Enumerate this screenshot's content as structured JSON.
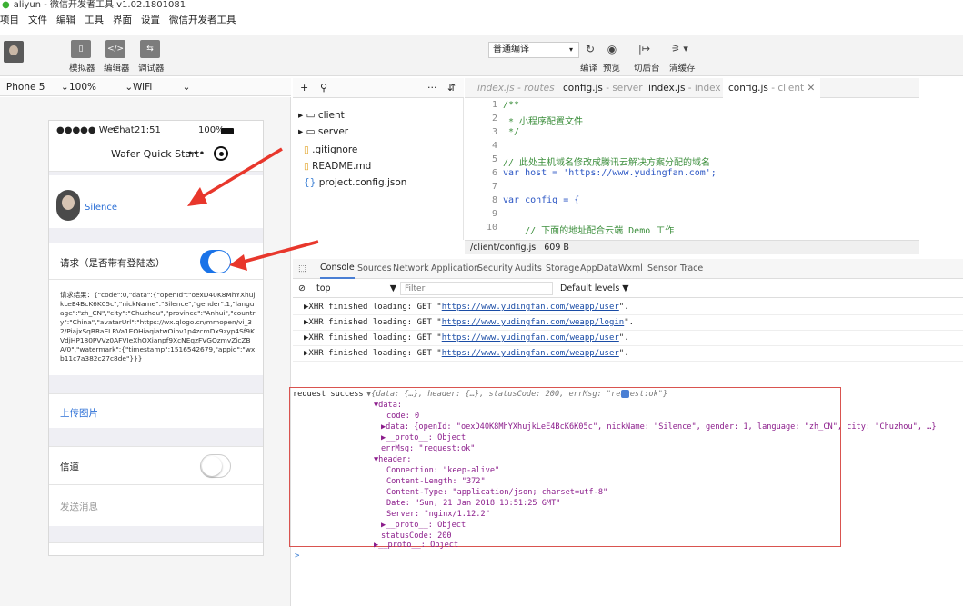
{
  "window": {
    "title": "aliyun - 微信开发者工具 v1.02.1801081"
  },
  "menu": [
    "项目",
    "文件",
    "编辑",
    "工具",
    "界面",
    "设置",
    "微信开发者工具"
  ],
  "toolbar": {
    "simulator": "模拟器",
    "editor": "编辑器",
    "debugger": "调试器",
    "compile_mode": "普通编译",
    "compile": "编译",
    "preview": "预览",
    "backend": "切后台",
    "clear_cache": "清缓存"
  },
  "device": {
    "model": "iPhone 5",
    "zoom": "100%",
    "network": "WiFi"
  },
  "phone": {
    "carrier": "●●●●● WeChat",
    "time": "21:51",
    "battery": "100%",
    "nav_title": "Wafer Quick Start",
    "nav_more": "•••",
    "user_name": "Silence",
    "login_request_label": "请求（是否带有登陆态）",
    "request_result": "请求结果：{\"code\":0,\"data\":{\"openId\":\"oexD40K8MhYXhujkLeE4BcK6K05c\",\"nickName\":\"Silence\",\"gender\":1,\"language\":\"zh_CN\",\"city\":\"Chuzhou\",\"province\":\"Anhui\",\"country\":\"China\",\"avatarUrl\":\"https://wx.qlogo.cn/mmopen/vi_32/PiajxSqBRaELRVa1EOHiaqiatwOibv1p4zcmDx9zyp4Sf9KVdjHP180PVVz0AFVIeXhQXianpf9XcNEqzFVGQzmvZicZBA/0\",\"watermark\":{\"timestamp\":1516542679,\"appid\":\"wxb11c7a382c27c8de\"}}}",
    "upload_image": "上传图片",
    "channel_label": "信道",
    "send_message": "发送消息"
  },
  "editor": {
    "files": [
      "client",
      "server",
      ".gitignore",
      "README.md",
      "project.config.json"
    ],
    "tabs": [
      {
        "name": "index.js",
        "path": "routes"
      },
      {
        "name": "config.js",
        "path": "server"
      },
      {
        "name": "index.js",
        "path": "index"
      },
      {
        "name": "config.js",
        "path": "client"
      }
    ],
    "code_lines": [
      {
        "n": "1",
        "t": "/**"
      },
      {
        "n": "2",
        "t": " * 小程序配置文件"
      },
      {
        "n": "3",
        "t": " */"
      },
      {
        "n": "4",
        "t": ""
      },
      {
        "n": "5",
        "t": "// 此处主机域名修改成腾讯云解决方案分配的域名"
      },
      {
        "n": "6",
        "t": "var host = 'https://www.yudingfan.com';"
      },
      {
        "n": "7",
        "t": ""
      },
      {
        "n": "8",
        "t": "var config = {"
      },
      {
        "n": "9",
        "t": ""
      },
      {
        "n": "10",
        "t": "    // 下面的地址配合云端 Demo 工作"
      }
    ],
    "status_path": "/client/config.js",
    "status_size": "609 B"
  },
  "devtools": {
    "tabs": [
      "Console",
      "Sources",
      "Network",
      "Application",
      "Security",
      "Audits",
      "Storage",
      "AppData",
      "Wxml",
      "Sensor",
      "Trace"
    ],
    "context": "top",
    "filter_placeholder": "Filter",
    "levels": "Default levels ▼"
  },
  "console": {
    "xhr_prefix": "▶XHR finished loading: GET \"",
    "xhr_urls": [
      "https://www.yudingfan.com/weapp/user",
      "https://www.yudingfan.com/weapp/login",
      "https://www.yudingfan.com/weapp/user",
      "https://www.yudingfan.com/weapp/user"
    ],
    "xhr_suffix": "\".",
    "success_label": "request success",
    "success_summary": "▼{data: {…}, header: {…}, statusCode: 200, errMsg: \"request:ok\"}",
    "lines": {
      "data": "▼data:",
      "code": "code: 0",
      "data_inner": "▶data: {openId: \"oexD40K8MhYXhujkLeE4BcK6K05c\", nickName: \"Silence\", gender: 1, language: \"zh_CN\", city: \"Chuzhou\", …}",
      "proto1": "▶__proto__: Object",
      "errmsg": "errMsg: \"request:ok\"",
      "header": "▼header:",
      "connection": "Connection: \"keep-alive\"",
      "content_length": "Content-Length: \"372\"",
      "content_type": "Content-Type: \"application/json; charset=utf-8\"",
      "date": "Date: \"Sun, 21 Jan 2018 13:51:25 GMT\"",
      "server": "Server: \"nginx/1.12.2\"",
      "proto2": "▶__proto__: Object",
      "status": "statusCode: 200",
      "proto3": "▶__proto__: Object"
    },
    "prompt": ">"
  },
  "colors": {
    "accent": "#1a73e8",
    "annotation": "#e8372c",
    "highlight_box": "#d9534f"
  }
}
